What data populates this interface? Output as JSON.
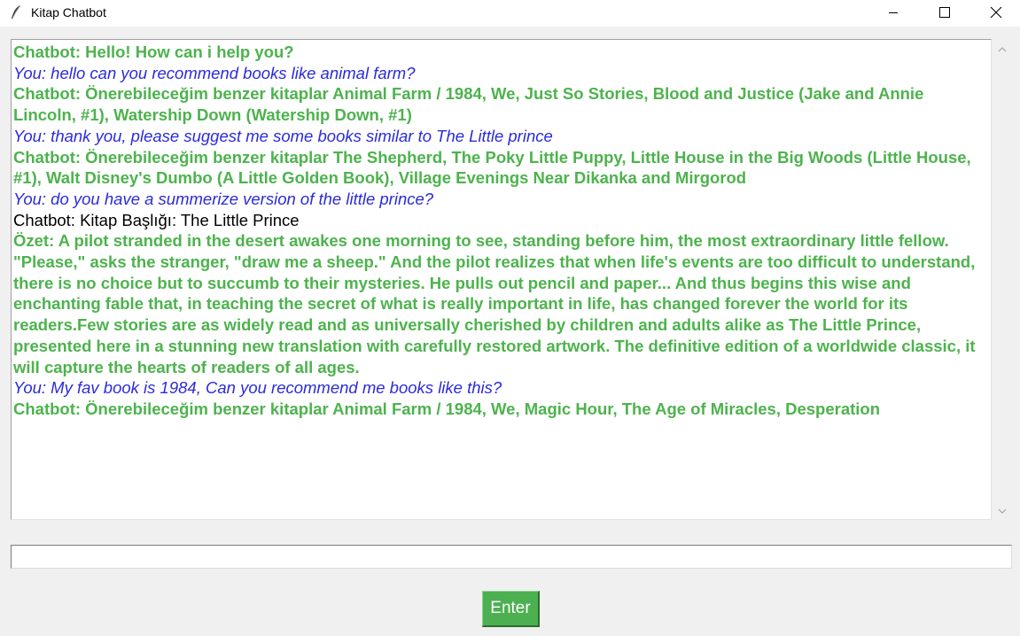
{
  "window": {
    "title": "Kitap Chatbot",
    "icon": "feather-icon"
  },
  "titlebar_buttons": {
    "minimize_icon": "minimize-icon",
    "maximize_icon": "maximize-icon",
    "close_icon": "close-icon"
  },
  "chat": {
    "messages": [
      {
        "role": "bot",
        "text": "Chatbot: Hello! How can i help you?"
      },
      {
        "role": "user",
        "text": "You: hello can you recommend books like animal farm?"
      },
      {
        "role": "bot",
        "text": "Chatbot: Önerebileceğim benzer kitaplar Animal Farm / 1984, We, Just So Stories, Blood and Justice (Jake and Annie Lincoln, #1), Watership Down (Watership Down, #1)"
      },
      {
        "role": "user",
        "text": "You: thank you, please suggest me some books similar to The Little prince"
      },
      {
        "role": "bot",
        "text": "Chatbot: Önerebileceğim benzer kitaplar The Shepherd, The Poky Little Puppy, Little House in the Big Woods (Little House, #1), Walt Disney's Dumbo (A Little Golden Book), Village Evenings Near Dikanka and Mirgorod"
      },
      {
        "role": "user",
        "text": "You: do you have a summerize version of the little prince?"
      },
      {
        "role": "plain",
        "text": "Chatbot: Kitap Başlığı: The Little Prince"
      },
      {
        "role": "bot",
        "text": "Özet: A pilot stranded in the desert awakes one morning to see, standing before him, the most extraordinary little fellow. \"Please,\" asks the stranger, \"draw me a sheep.\" And the pilot realizes that when life's events are too difficult to understand, there is no choice but to succumb to their mysteries. He pulls out pencil and paper... And thus begins this wise and enchanting fable that, in teaching the secret of what is really important in life, has changed forever the world for its readers.Few stories are as widely read and as universally cherished by children and adults alike as The Little Prince, presented here in a stunning new translation with carefully restored artwork. The definitive edition of a worldwide classic, it will capture the hearts of readers of all ages."
      },
      {
        "role": "user",
        "text": "You: My fav book is 1984, Can you recommend me books like this?"
      },
      {
        "role": "bot",
        "text": "Chatbot: Önerebileceğim benzer kitaplar Animal Farm / 1984, We, Magic Hour, The Age of Miracles, Desperation"
      }
    ]
  },
  "colors": {
    "bot_text": "#4db34d",
    "user_text": "#2b2bdb",
    "plain_text": "#000000",
    "button_bg": "#4caf50"
  },
  "input": {
    "value": "",
    "placeholder": ""
  },
  "enter_button": {
    "label": "Enter"
  },
  "scrollbar": {
    "up_icon": "chevron-up-icon",
    "down_icon": "chevron-down-icon"
  }
}
